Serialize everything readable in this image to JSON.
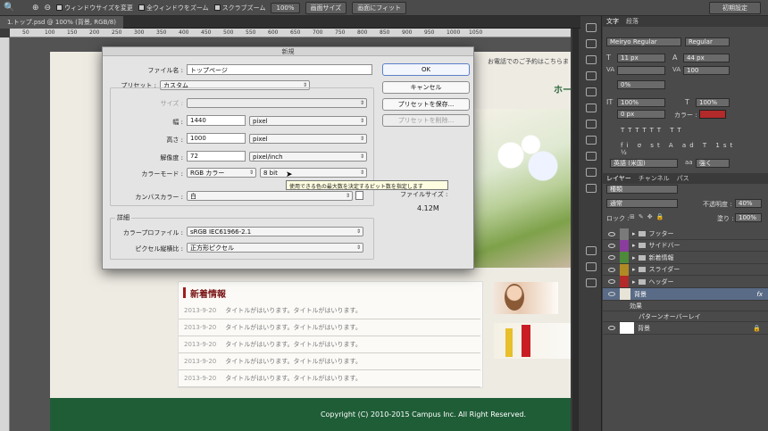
{
  "optionsbar": {
    "chk_resize": "ウィンドウサイズを変更",
    "chk_allwin": "全ウィンドウをズーム",
    "chk_scrubby": "スクラブズーム",
    "zoom_value": "100%",
    "fit_screen": "画面サイズ",
    "fill_screen": "画面にフィット",
    "workspace": "初期設定"
  },
  "document_tab": "1.トップ.psd @ 100% (背景, RGB/8)",
  "ruler_ticks": [
    "50",
    "100",
    "150",
    "200",
    "250",
    "300",
    "350",
    "400",
    "450",
    "500",
    "550",
    "600",
    "650",
    "700",
    "750",
    "800",
    "850",
    "900",
    "950",
    "1000",
    "1050"
  ],
  "page": {
    "tel_text": "お電話でのご予約はこちらま",
    "heading_partial": "ホー",
    "news_title": "新着情報",
    "news_items": [
      {
        "date": "2013-9-20",
        "text": "タイトルがはいります。タイトルがはいります。"
      },
      {
        "date": "2013-9-20",
        "text": "タイトルがはいります。タイトルがはいります。"
      },
      {
        "date": "2013-9-20",
        "text": "タイトルがはいります。タイトルがはいります。"
      },
      {
        "date": "2013-9-20",
        "text": "タイトルがはいります。タイトルがはいります。"
      },
      {
        "date": "2013-9-20",
        "text": "タイトルがはいります。タイトルがはいります。"
      }
    ],
    "footer_copyright": "Copyright (C) 2010-2015 Campus Inc. All Right Reserved."
  },
  "dialog": {
    "title": "新規",
    "filename_label": "ファイル名 :",
    "filename_value": "トップページ",
    "preset_label": "プリセット :",
    "preset_value": "カスタム",
    "size_label": "サイズ :",
    "width_label": "幅 :",
    "width_value": "1440",
    "width_unit": "pixel",
    "height_label": "高さ :",
    "height_value": "1000",
    "height_unit": "pixel",
    "resolution_label": "解像度 :",
    "resolution_value": "72",
    "resolution_unit": "pixel/inch",
    "colormode_label": "カラーモード :",
    "colormode_value": "RGB カラー",
    "bitdepth_value": "8 bit",
    "canvas_color_label": "カンバスカラー :",
    "canvas_color_value": "白",
    "filesize_label": "ファイルサイズ :",
    "filesize_value": "4.12M",
    "advanced_label": "詳細",
    "profile_label": "カラープロファイル :",
    "profile_value": "sRGB IEC61966-2.1",
    "aspect_label": "ピクセル縦横比 :",
    "aspect_value": "正方形ピクセル",
    "ok_button": "OK",
    "cancel_button": "キャンセル",
    "save_preset_button": "プリセットを保存...",
    "delete_preset_button": "プリセットを削除...",
    "tooltip": "使用できる色の最大数を決定するピット数を指定します"
  },
  "char_panel": {
    "tab_char": "文字",
    "tab_para": "段落",
    "font_family": "Meiryo Regular",
    "font_style": "Regular",
    "font_size": "11 px",
    "leading": "44 px",
    "tracking": "100",
    "kerning": "0%",
    "vscale": "100%",
    "hscale": "100%",
    "baseline": "0 px",
    "color_label": "カラー :",
    "language": "英語 (米国)",
    "antialias": "強く",
    "color_swatch": "#b22a2a"
  },
  "layers_panel": {
    "tab_layers": "レイヤー",
    "tab_channels": "チャンネル",
    "tab_paths": "パス",
    "filter_kind": "種類",
    "blend_mode": "通常",
    "opacity_label": "不透明度 :",
    "opacity_value": "40%",
    "lock_label": "ロック :",
    "fill_label": "塗り :",
    "fill_value": "100%",
    "layers": [
      {
        "name": "フッター",
        "color": "#7a7a7a"
      },
      {
        "name": "サイドバー",
        "color": "#8a3d9c"
      },
      {
        "name": "新着情報",
        "color": "#4d8a3a"
      },
      {
        "name": "スライダー",
        "color": "#b08a25"
      },
      {
        "name": "ヘッダー",
        "color": "#b22a2a"
      }
    ],
    "bg_group": "背景",
    "effects_label": "効果",
    "pattern_overlay": "パターンオーバーレイ",
    "background_layer": "背景",
    "fx_label": "fx"
  }
}
